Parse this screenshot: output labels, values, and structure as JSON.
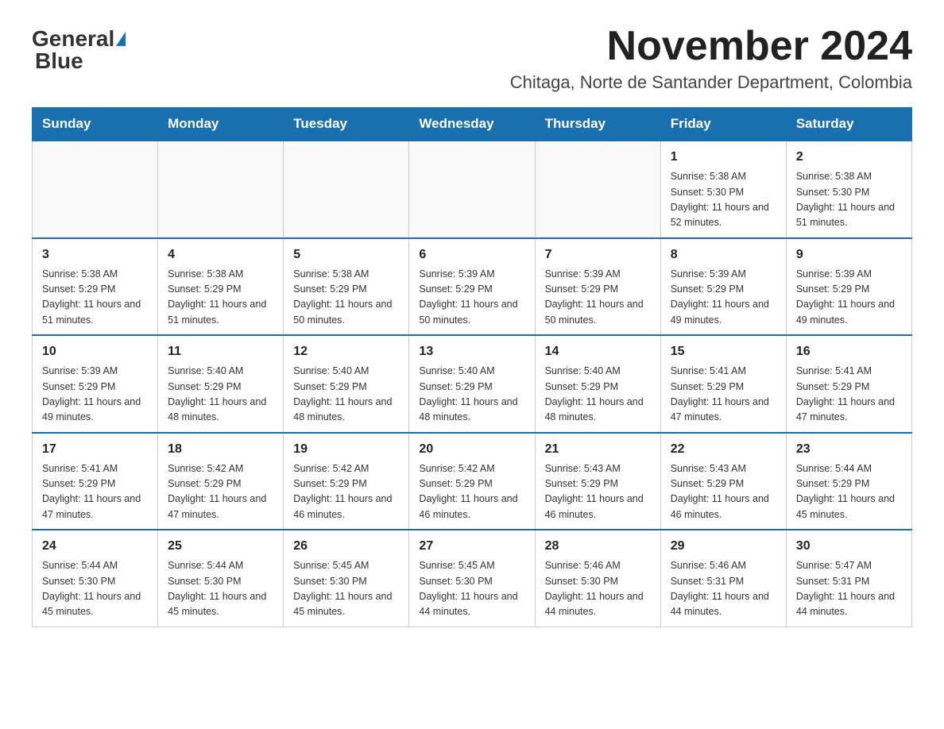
{
  "logo": {
    "text_general": "General",
    "text_blue": "Blue"
  },
  "header": {
    "title": "November 2024",
    "subtitle": "Chitaga, Norte de Santander Department, Colombia"
  },
  "days_of_week": [
    "Sunday",
    "Monday",
    "Tuesday",
    "Wednesday",
    "Thursday",
    "Friday",
    "Saturday"
  ],
  "weeks": [
    [
      {
        "day": "",
        "info": ""
      },
      {
        "day": "",
        "info": ""
      },
      {
        "day": "",
        "info": ""
      },
      {
        "day": "",
        "info": ""
      },
      {
        "day": "",
        "info": ""
      },
      {
        "day": "1",
        "info": "Sunrise: 5:38 AM\nSunset: 5:30 PM\nDaylight: 11 hours and 52 minutes."
      },
      {
        "day": "2",
        "info": "Sunrise: 5:38 AM\nSunset: 5:30 PM\nDaylight: 11 hours and 51 minutes."
      }
    ],
    [
      {
        "day": "3",
        "info": "Sunrise: 5:38 AM\nSunset: 5:29 PM\nDaylight: 11 hours and 51 minutes."
      },
      {
        "day": "4",
        "info": "Sunrise: 5:38 AM\nSunset: 5:29 PM\nDaylight: 11 hours and 51 minutes."
      },
      {
        "day": "5",
        "info": "Sunrise: 5:38 AM\nSunset: 5:29 PM\nDaylight: 11 hours and 50 minutes."
      },
      {
        "day": "6",
        "info": "Sunrise: 5:39 AM\nSunset: 5:29 PM\nDaylight: 11 hours and 50 minutes."
      },
      {
        "day": "7",
        "info": "Sunrise: 5:39 AM\nSunset: 5:29 PM\nDaylight: 11 hours and 50 minutes."
      },
      {
        "day": "8",
        "info": "Sunrise: 5:39 AM\nSunset: 5:29 PM\nDaylight: 11 hours and 49 minutes."
      },
      {
        "day": "9",
        "info": "Sunrise: 5:39 AM\nSunset: 5:29 PM\nDaylight: 11 hours and 49 minutes."
      }
    ],
    [
      {
        "day": "10",
        "info": "Sunrise: 5:39 AM\nSunset: 5:29 PM\nDaylight: 11 hours and 49 minutes."
      },
      {
        "day": "11",
        "info": "Sunrise: 5:40 AM\nSunset: 5:29 PM\nDaylight: 11 hours and 48 minutes."
      },
      {
        "day": "12",
        "info": "Sunrise: 5:40 AM\nSunset: 5:29 PM\nDaylight: 11 hours and 48 minutes."
      },
      {
        "day": "13",
        "info": "Sunrise: 5:40 AM\nSunset: 5:29 PM\nDaylight: 11 hours and 48 minutes."
      },
      {
        "day": "14",
        "info": "Sunrise: 5:40 AM\nSunset: 5:29 PM\nDaylight: 11 hours and 48 minutes."
      },
      {
        "day": "15",
        "info": "Sunrise: 5:41 AM\nSunset: 5:29 PM\nDaylight: 11 hours and 47 minutes."
      },
      {
        "day": "16",
        "info": "Sunrise: 5:41 AM\nSunset: 5:29 PM\nDaylight: 11 hours and 47 minutes."
      }
    ],
    [
      {
        "day": "17",
        "info": "Sunrise: 5:41 AM\nSunset: 5:29 PM\nDaylight: 11 hours and 47 minutes."
      },
      {
        "day": "18",
        "info": "Sunrise: 5:42 AM\nSunset: 5:29 PM\nDaylight: 11 hours and 47 minutes."
      },
      {
        "day": "19",
        "info": "Sunrise: 5:42 AM\nSunset: 5:29 PM\nDaylight: 11 hours and 46 minutes."
      },
      {
        "day": "20",
        "info": "Sunrise: 5:42 AM\nSunset: 5:29 PM\nDaylight: 11 hours and 46 minutes."
      },
      {
        "day": "21",
        "info": "Sunrise: 5:43 AM\nSunset: 5:29 PM\nDaylight: 11 hours and 46 minutes."
      },
      {
        "day": "22",
        "info": "Sunrise: 5:43 AM\nSunset: 5:29 PM\nDaylight: 11 hours and 46 minutes."
      },
      {
        "day": "23",
        "info": "Sunrise: 5:44 AM\nSunset: 5:29 PM\nDaylight: 11 hours and 45 minutes."
      }
    ],
    [
      {
        "day": "24",
        "info": "Sunrise: 5:44 AM\nSunset: 5:30 PM\nDaylight: 11 hours and 45 minutes."
      },
      {
        "day": "25",
        "info": "Sunrise: 5:44 AM\nSunset: 5:30 PM\nDaylight: 11 hours and 45 minutes."
      },
      {
        "day": "26",
        "info": "Sunrise: 5:45 AM\nSunset: 5:30 PM\nDaylight: 11 hours and 45 minutes."
      },
      {
        "day": "27",
        "info": "Sunrise: 5:45 AM\nSunset: 5:30 PM\nDaylight: 11 hours and 44 minutes."
      },
      {
        "day": "28",
        "info": "Sunrise: 5:46 AM\nSunset: 5:30 PM\nDaylight: 11 hours and 44 minutes."
      },
      {
        "day": "29",
        "info": "Sunrise: 5:46 AM\nSunset: 5:31 PM\nDaylight: 11 hours and 44 minutes."
      },
      {
        "day": "30",
        "info": "Sunrise: 5:47 AM\nSunset: 5:31 PM\nDaylight: 11 hours and 44 minutes."
      }
    ]
  ]
}
